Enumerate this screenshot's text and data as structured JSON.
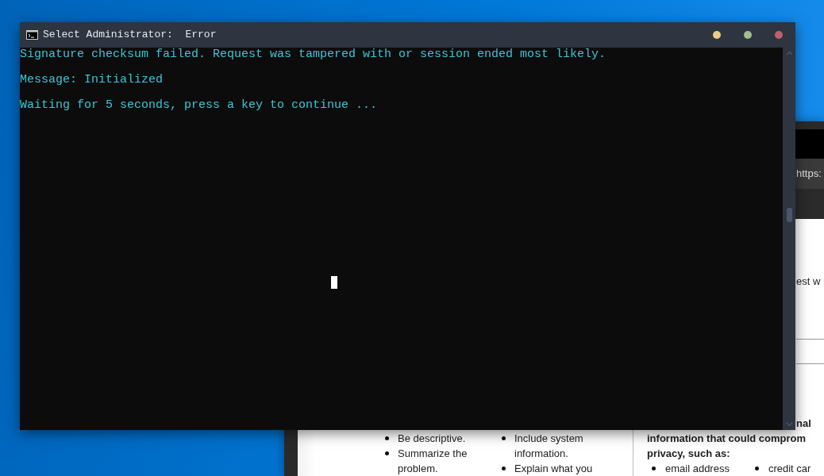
{
  "background_window": {
    "address": "https:",
    "page": {
      "fragment": "est w",
      "tips_left": [
        "Be descriptive.",
        "Summarize the problem."
      ],
      "tips_right": [
        "Include system information.",
        "Explain what you"
      ],
      "warning_heading_end": "nal",
      "warning_text": "information that could comprom privacy, such as:",
      "examples": [
        "email address",
        "credit car"
      ]
    }
  },
  "terminal": {
    "title": "Select Administrator:  Error",
    "controls": [
      {
        "color": "#ebcb8b"
      },
      {
        "color": "#a3be8c"
      },
      {
        "color": "#bf616a"
      }
    ],
    "lines": [
      "Signature checksum failed. Request was tampered with or session ended most likely.",
      "Message: Initialized",
      "Waiting for 5 seconds, press a key to continue ..."
    ]
  }
}
